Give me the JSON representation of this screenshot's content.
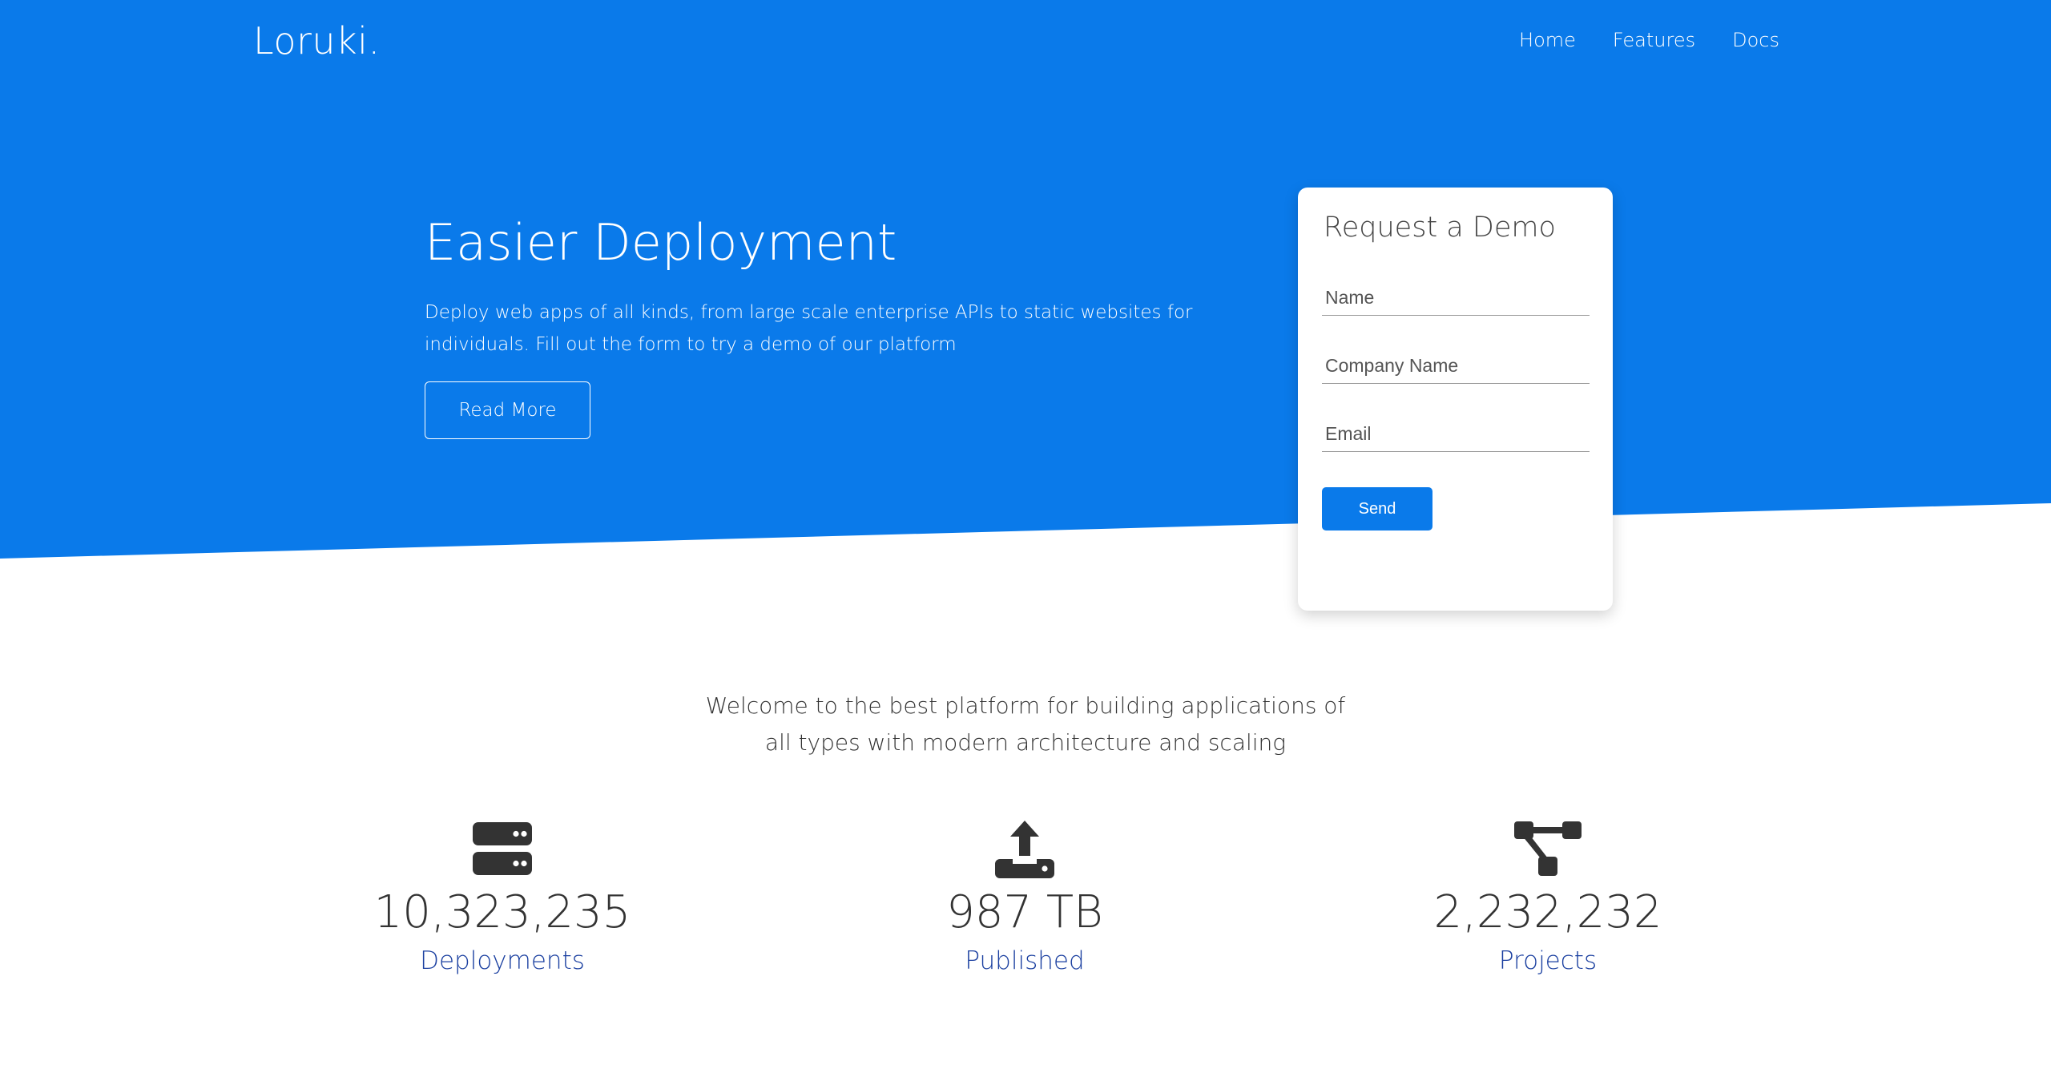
{
  "brand": {
    "logo": "Loruki."
  },
  "nav": {
    "items": [
      "Home",
      "Features",
      "Docs"
    ]
  },
  "hero": {
    "title": "Easier Deployment",
    "subtitle": "Deploy web apps of all kinds, from large scale enterprise APIs to static websites for individuals. Fill out the form to try a demo of our platform",
    "read_more": "Read More"
  },
  "demo_form": {
    "title": "Request a Demo",
    "name_placeholder": "Name",
    "company_placeholder": "Company Name",
    "email_placeholder": "Email",
    "send_label": "Send"
  },
  "welcome": {
    "text": "Welcome to the best platform for building applications of all types with modern architecture and scaling"
  },
  "stats": [
    {
      "icon": "server-icon",
      "value": "10,323,235",
      "label": "Deployments"
    },
    {
      "icon": "upload-icon",
      "value": "987 TB",
      "label": "Published"
    },
    {
      "icon": "project-diagram-icon",
      "value": "2,232,232",
      "label": "Projects"
    }
  ],
  "colors": {
    "primary": "#0a7aea",
    "text_dark": "#333333",
    "stat_label": "#1a3fa0"
  }
}
